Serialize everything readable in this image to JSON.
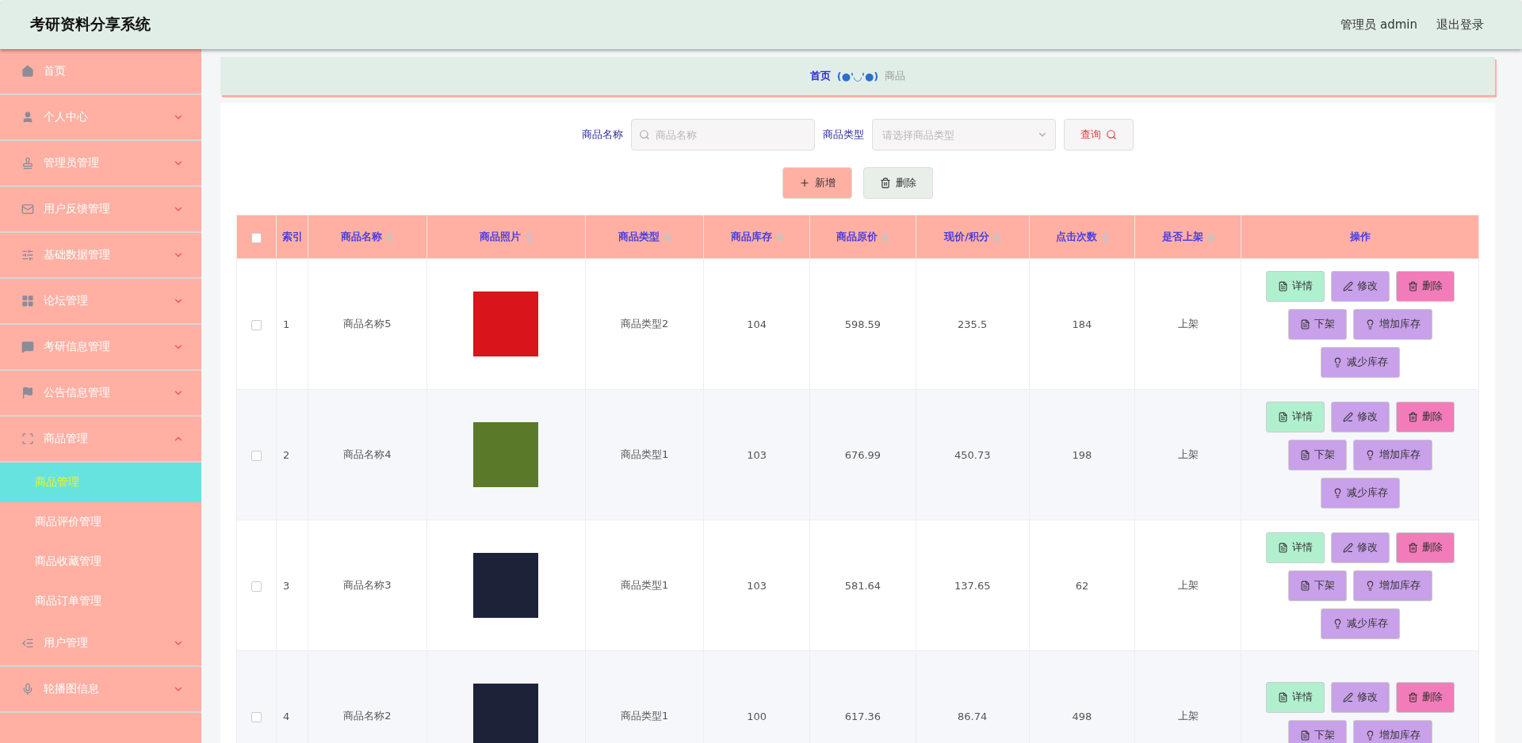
{
  "header": {
    "title": "考研资料分享系统",
    "user": "管理员 admin",
    "logout": "退出登录"
  },
  "sidebar": {
    "items": [
      {
        "label": "首页",
        "expandable": false
      },
      {
        "label": "个人中心",
        "expandable": true,
        "expanded": false
      },
      {
        "label": "管理员管理",
        "expandable": true,
        "expanded": false
      },
      {
        "label": "用户反馈管理",
        "expandable": true,
        "expanded": false
      },
      {
        "label": "基础数据管理",
        "expandable": true,
        "expanded": false
      },
      {
        "label": "论坛管理",
        "expandable": true,
        "expanded": false
      },
      {
        "label": "考研信息管理",
        "expandable": true,
        "expanded": false
      },
      {
        "label": "公告信息管理",
        "expandable": true,
        "expanded": false
      },
      {
        "label": "商品管理",
        "expandable": true,
        "expanded": true,
        "children": [
          {
            "label": "商品管理",
            "selected": true
          },
          {
            "label": "商品评价管理",
            "selected": false
          },
          {
            "label": "商品收藏管理",
            "selected": false
          },
          {
            "label": "商品订单管理",
            "selected": false
          }
        ]
      },
      {
        "label": "用户管理",
        "expandable": true,
        "expanded": false
      },
      {
        "label": "轮播图信息",
        "expandable": true,
        "expanded": false
      }
    ]
  },
  "breadcrumb": {
    "home": "首页",
    "separator": "(●'◡'●)",
    "current": "商品"
  },
  "search": {
    "name_label": "商品名称",
    "name_placeholder": "商品名称",
    "type_label": "商品类型",
    "type_placeholder": "请选择商品类型",
    "query_button": "查询"
  },
  "actions": {
    "add": "新增",
    "delete": "删除"
  },
  "table": {
    "select_all_checked": false,
    "columns": [
      {
        "label": "索引",
        "sortable": false
      },
      {
        "label": "商品名称",
        "sortable": true
      },
      {
        "label": "商品照片",
        "sortable": true
      },
      {
        "label": "商品类型",
        "sortable": true
      },
      {
        "label": "商品库存",
        "sortable": true
      },
      {
        "label": "商品原价",
        "sortable": true
      },
      {
        "label": "现价/积分",
        "sortable": true
      },
      {
        "label": "点击次数",
        "sortable": true
      },
      {
        "label": "是否上架",
        "sortable": true
      },
      {
        "label": "操作",
        "sortable": false
      }
    ],
    "rows": [
      {
        "checked": false,
        "index": "1",
        "name": "商品名称5",
        "type": "商品类型2",
        "stock": "104",
        "price": "598.59",
        "current_price": "235.5",
        "clicks": "184",
        "status": "上架",
        "actions": [
          {
            "kind": "detail",
            "label": "详情"
          },
          {
            "kind": "edit",
            "label": "修改"
          },
          {
            "kind": "delete",
            "label": "删除"
          },
          {
            "kind": "down",
            "label": "下架"
          },
          {
            "kind": "add",
            "label": "增加库存"
          },
          {
            "kind": "reduce",
            "label": "减少库存"
          }
        ]
      },
      {
        "checked": false,
        "index": "2",
        "name": "商品名称4",
        "type": "商品类型1",
        "stock": "103",
        "price": "676.99",
        "current_price": "450.73",
        "clicks": "198",
        "status": "上架",
        "actions": [
          {
            "kind": "detail",
            "label": "详情"
          },
          {
            "kind": "edit",
            "label": "修改"
          },
          {
            "kind": "delete",
            "label": "删除"
          },
          {
            "kind": "down",
            "label": "下架"
          },
          {
            "kind": "add",
            "label": "增加库存"
          },
          {
            "kind": "reduce",
            "label": "减少库存"
          }
        ]
      },
      {
        "checked": false,
        "index": "3",
        "name": "商品名称3",
        "type": "商品类型1",
        "stock": "103",
        "price": "581.64",
        "current_price": "137.65",
        "clicks": "62",
        "status": "上架",
        "actions": [
          {
            "kind": "detail",
            "label": "详情"
          },
          {
            "kind": "edit",
            "label": "修改"
          },
          {
            "kind": "delete",
            "label": "删除"
          },
          {
            "kind": "down",
            "label": "下架"
          },
          {
            "kind": "add",
            "label": "增加库存"
          },
          {
            "kind": "reduce",
            "label": "减少库存"
          }
        ]
      },
      {
        "checked": false,
        "index": "4",
        "name": "商品名称2",
        "type": "商品类型1",
        "stock": "100",
        "price": "617.36",
        "current_price": "86.74",
        "clicks": "498",
        "status": "上架",
        "actions": [
          {
            "kind": "detail",
            "label": "详情"
          },
          {
            "kind": "edit",
            "label": "修改"
          },
          {
            "kind": "delete",
            "label": "删除"
          },
          {
            "kind": "down",
            "label": "下架"
          },
          {
            "kind": "add",
            "label": "增加库存"
          }
        ]
      }
    ]
  }
}
